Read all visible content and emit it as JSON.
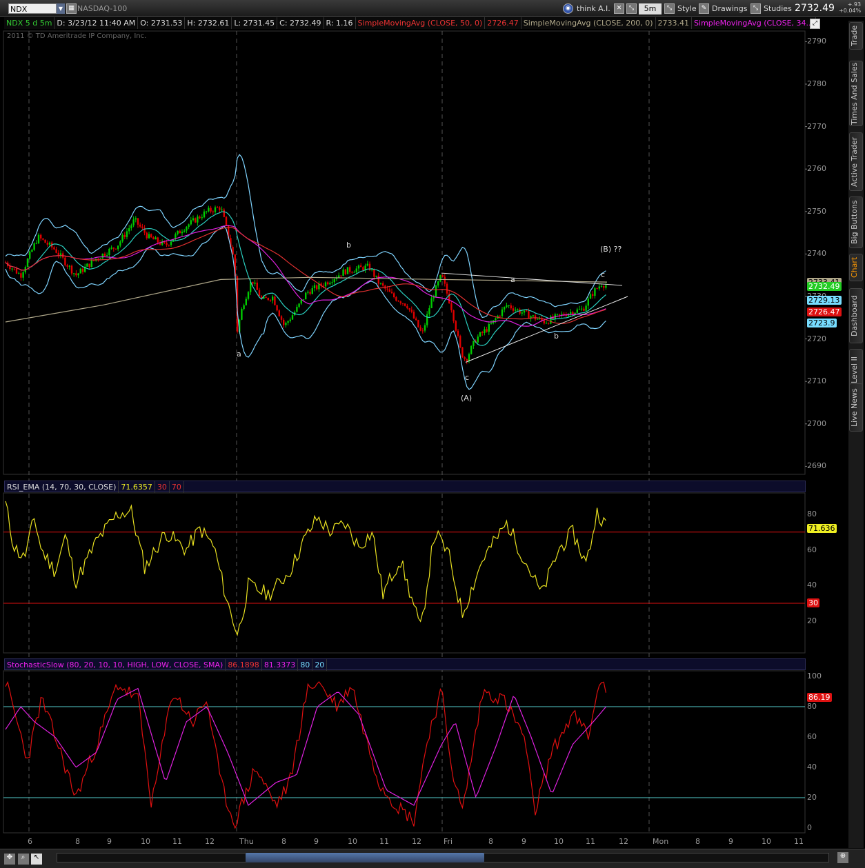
{
  "topbar": {
    "symbol": "NDX",
    "symbol_name": "NASDAQ-100",
    "think": "think A.I.",
    "timeframe": "5m",
    "style": "Style",
    "drawings": "Drawings",
    "studies": "Studies",
    "last": "2732.49",
    "change_abs": "+.93",
    "change_pct": "+0.04%"
  },
  "info": {
    "period": "NDX 5 d 5m",
    "date": "D: 3/23/12 11:40 AM",
    "open": "O: 2731.53",
    "high": "H: 2732.61",
    "low": "L: 2731.45",
    "close": "C: 2732.49",
    "range": "R: 1.16",
    "sma50": "SimpleMovingAvg (CLOSE, 50, 0)",
    "sma50_val": "2726.47",
    "sma200": "SimpleMovingAvg (CLOSE, 200, 0)",
    "sma200_val": "2733.41",
    "sma34": "SimpleMovingAvg (CLOSE, 34..."
  },
  "copyright": "2011 © TD Ameritrade IP Company, Inc.",
  "price_axis": [
    "2790",
    "2780",
    "2770",
    "2760",
    "2750",
    "2740",
    "2730",
    "2720",
    "2710",
    "2700",
    "2690"
  ],
  "price_tags": {
    "sma200": "2733.41",
    "last": "2732.49",
    "bb_mid": "2729.13",
    "sma50": "2726.47",
    "bb_low": "2723.9"
  },
  "wave_labels": {
    "a1": "a",
    "b1": "b",
    "c1": "c",
    "A": "(A)",
    "a2": "a",
    "b2": "b",
    "c2": "c",
    "B": "(B) ??"
  },
  "rsi": {
    "title": "RSI_EMA (14, 70, 30, CLOSE)",
    "value": "71.6357",
    "os": "30",
    "ob": "70",
    "axis": [
      "80",
      "60",
      "40",
      "20"
    ],
    "tag": "71.636",
    "tag30": "30"
  },
  "stoch": {
    "title": "StochasticSlow (80, 20, 10, 10, HIGH, LOW, CLOSE, SMA)",
    "k": "86.1898",
    "d": "81.3373",
    "ob": "80",
    "os": "20",
    "axis": [
      "100",
      "80",
      "60",
      "40",
      "20",
      "0"
    ],
    "tag": "86.19"
  },
  "x_axis": [
    "6",
    "8",
    "9",
    "10",
    "11",
    "12",
    "Thu",
    "8",
    "9",
    "10",
    "11",
    "12",
    "Fri",
    "8",
    "9",
    "10",
    "11",
    "12",
    "Mon",
    "8",
    "9",
    "10",
    "11"
  ],
  "side_tabs": [
    "Trade",
    "Times And Sales",
    "Active Trader",
    "Big Buttons",
    "Chart",
    "Dashboard",
    "Level II",
    "Live News"
  ],
  "colors": {
    "up": "#00cc00",
    "down": "#e00000",
    "bb": "#7fd4ff",
    "sma50": "#e03030",
    "sma34": "#e020e0",
    "sma200": "#b0a88a",
    "rsi": "#e8e020",
    "k": "#e01010",
    "d": "#e020e0"
  }
}
